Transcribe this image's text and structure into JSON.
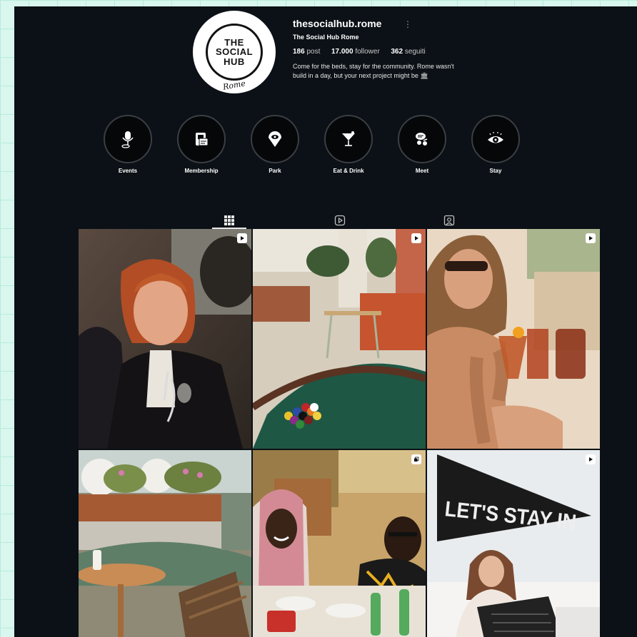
{
  "profile": {
    "username": "thesocialhub.rome",
    "full_name": "The Social Hub Rome",
    "posts_count": "186",
    "posts_label": "post",
    "followers_count": "17.000",
    "followers_label": "follower",
    "following_count": "362",
    "following_label": "seguiti",
    "bio_line1": "Come for the beds, stay for the community. Rome wasn't",
    "bio_line2": "build in a day, but your next project might be 🏛",
    "avatar": {
      "line1": "THE",
      "line2": "SOCIAL",
      "line3": "HUB",
      "city": "Rome"
    }
  },
  "highlights": [
    {
      "label": "Events",
      "icon": "microphone-icon"
    },
    {
      "label": "Membership",
      "icon": "membership-card-icon"
    },
    {
      "label": "Park",
      "icon": "location-pin-icon"
    },
    {
      "label": "Eat & Drink",
      "icon": "cocktail-icon"
    },
    {
      "label": "Meet",
      "icon": "meeting-icon"
    },
    {
      "label": "Stay",
      "icon": "eye-icon"
    }
  ],
  "tabs": [
    {
      "name": "posts",
      "icon": "grid-icon",
      "active": true
    },
    {
      "name": "reels",
      "icon": "reels-icon",
      "active": false
    },
    {
      "name": "tagged",
      "icon": "tagged-icon",
      "active": false
    }
  ],
  "posts": [
    {
      "subject": "woman-smiling-wine",
      "badge": "reel-icon"
    },
    {
      "subject": "pool-table-lounge",
      "badge": "reel-icon"
    },
    {
      "subject": "cocktails-toast",
      "badge": "reel-icon"
    },
    {
      "subject": "terrace-seating",
      "badge": "none"
    },
    {
      "subject": "two-men-dining",
      "badge": "carousel-icon"
    },
    {
      "subject": "lets-stay-in-pennant",
      "badge": "reel-icon",
      "pennant_text": "LET'S STAY IN"
    }
  ],
  "colors": {
    "background": "#0b1116",
    "outer": "#d9f7ee",
    "text": "#ffffff",
    "muted": "#c9c9c9"
  }
}
